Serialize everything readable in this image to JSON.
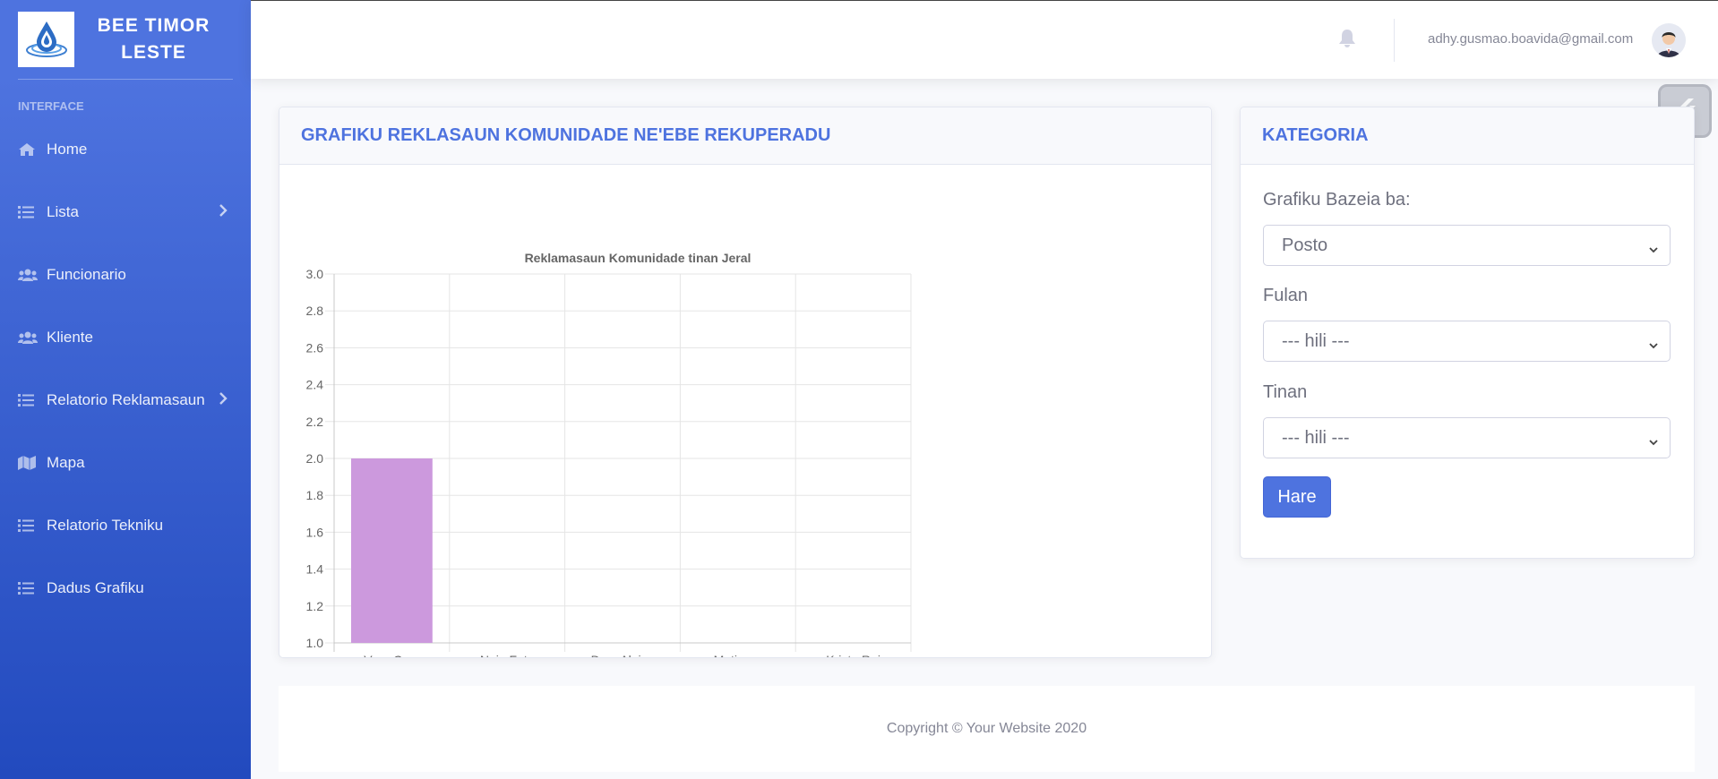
{
  "sidebar": {
    "brand": "BEE TIMOR LESTE",
    "heading": "INTERFACE",
    "items": [
      {
        "label": "Home",
        "icon": "home-icon"
      },
      {
        "label": "Lista",
        "icon": "list-icon",
        "has_children": true
      },
      {
        "label": "Funcionario",
        "icon": "users-icon"
      },
      {
        "label": "Kliente",
        "icon": "users-icon"
      },
      {
        "label": "Relatorio Reklamasaun",
        "icon": "list-icon",
        "has_children": true
      },
      {
        "label": "Mapa",
        "icon": "map-icon"
      },
      {
        "label": "Relatorio Tekniku",
        "icon": "list-icon"
      },
      {
        "label": "Dadus Grafiku",
        "icon": "list-icon"
      }
    ]
  },
  "topbar": {
    "user_email": "adhy.gusmao.boavida@gmail.com"
  },
  "chart_card": {
    "title": "GRAFIKU REKLASAUN KOMUNIDADE NE'EBE REKUPERADU"
  },
  "chart_data": {
    "type": "bar",
    "title": "Reklamasaun Komunidade tinan Jeral",
    "categories": [
      "Vera Cruz",
      "Nain Feto",
      "Dom Aleixo",
      "Metinaru",
      "Kristu Rei"
    ],
    "values": [
      2.0,
      null,
      null,
      null,
      null
    ],
    "ylim": [
      1.0,
      3.0
    ],
    "yticks": [
      "3.0",
      "2.8",
      "2.6",
      "2.4",
      "2.2",
      "2.0",
      "1.8",
      "1.6",
      "1.4",
      "1.2",
      "1.0"
    ],
    "grid": true,
    "bar_color": "#cc99dd"
  },
  "kategoria": {
    "title": "KATEGORIA",
    "label_basis": "Grafiku Bazeia ba:",
    "basis_value": "Posto",
    "label_month": "Fulan",
    "month_value": "--- hili ---",
    "label_year": "Tinan",
    "year_value": "--- hili ---",
    "submit_label": "Hare"
  },
  "footer": {
    "copyright": "Copyright © Your Website 2020"
  },
  "colors": {
    "primary": "#4e73df",
    "sidebar_dark": "#224abe"
  }
}
